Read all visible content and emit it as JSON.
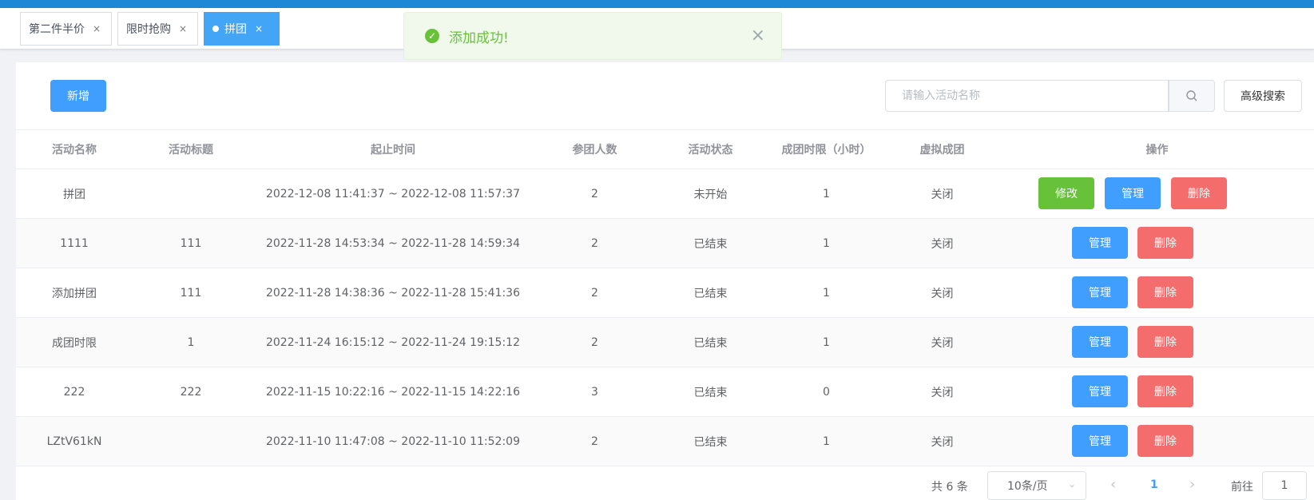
{
  "tabs": [
    {
      "label": "第二件半价",
      "close": "×"
    },
    {
      "label": "限时抢购",
      "close": "×"
    },
    {
      "label": "拼团",
      "close": "×"
    }
  ],
  "toast": {
    "message": "添加成功!",
    "close": "×"
  },
  "toolbar": {
    "add_label": "新增",
    "search_placeholder": "请输入活动名称",
    "advanced_search_label": "高级搜索"
  },
  "table": {
    "headers": [
      "活动名称",
      "活动标题",
      "起止时间",
      "参团人数",
      "活动状态",
      "成团时限（小时）",
      "虚拟成团",
      "操作"
    ],
    "rows": [
      {
        "name": "拼团",
        "title": "",
        "time": "2022-12-08 11:41:37 ~ 2022-12-08 11:57:37",
        "members": "2",
        "status": "未开始",
        "limit": "1",
        "virtual": "关闭",
        "edit": "修改",
        "manage": "管理",
        "delete": "删除"
      },
      {
        "name": "1111",
        "title": "111",
        "time": "2022-11-28 14:53:34 ~ 2022-11-28 14:59:34",
        "members": "2",
        "status": "已结束",
        "limit": "1",
        "virtual": "关闭",
        "manage": "管理",
        "delete": "删除"
      },
      {
        "name": "添加拼团",
        "title": "111",
        "time": "2022-11-28 14:38:36 ~ 2022-11-28 15:41:36",
        "members": "2",
        "status": "已结束",
        "limit": "1",
        "virtual": "关闭",
        "manage": "管理",
        "delete": "删除"
      },
      {
        "name": "成团时限",
        "title": "1",
        "time": "2022-11-24 16:15:12 ~ 2022-11-24 19:15:12",
        "members": "2",
        "status": "已结束",
        "limit": "1",
        "virtual": "关闭",
        "manage": "管理",
        "delete": "删除"
      },
      {
        "name": "222",
        "title": "222",
        "time": "2022-11-15 10:22:16 ~ 2022-11-15 14:22:16",
        "members": "3",
        "status": "已结束",
        "limit": "0",
        "virtual": "关闭",
        "manage": "管理",
        "delete": "删除"
      },
      {
        "name": "LZtV61kN",
        "title": "",
        "time": "2022-11-10 11:47:08 ~ 2022-11-10 11:52:09",
        "members": "2",
        "status": "已结束",
        "limit": "1",
        "virtual": "关闭",
        "manage": "管理",
        "delete": "删除"
      }
    ]
  },
  "pagination": {
    "total": "共 6 条",
    "page_size": "10条/页",
    "current_page": "1",
    "goto_label": "前往",
    "goto_value": "1"
  },
  "colors": {
    "primary": "#409eff",
    "success": "#67c23a",
    "danger": "#f56c6c",
    "topbar": "#1e88d6"
  },
  "icons": [
    "check-circle-icon",
    "close-icon",
    "search-icon",
    "chevron-down-icon",
    "chevron-left-icon",
    "chevron-right-icon"
  ]
}
